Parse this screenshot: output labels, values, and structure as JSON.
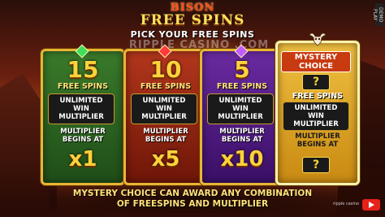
{
  "header": {
    "logo": "BISON",
    "title": "FREE SPINS",
    "subtitle": "PICK YOUR FREE SPINS",
    "watermark": "RIPPLE CASINO .COM"
  },
  "cards": [
    {
      "id": "green",
      "gem_color": "#3ee05a",
      "big_number": "15",
      "spins_label": "FREE SPINS",
      "pill_line1": "UNLIMITED",
      "pill_line2": "WIN",
      "pill_line3": "MULTIPLIER",
      "mult_line1": "MULTIPLIER",
      "mult_line2": "BEGINS AT",
      "mult_value": "x1"
    },
    {
      "id": "red",
      "gem_color": "#ff3a3a",
      "big_number": "10",
      "spins_label": "FREE SPINS",
      "pill_line1": "UNLIMITED",
      "pill_line2": "WIN",
      "pill_line3": "MULTIPLIER",
      "mult_line1": "MULTIPLIER",
      "mult_line2": "BEGINS AT",
      "mult_value": "x5"
    },
    {
      "id": "purple",
      "gem_color": "#c35cff",
      "big_number": "5",
      "spins_label": "FREE SPINS",
      "pill_line1": "UNLIMITED",
      "pill_line2": "WIN",
      "pill_line3": "MULTIPLIER",
      "mult_line1": "MULTIPLIER",
      "mult_line2": "BEGINS AT",
      "mult_value": "x10"
    },
    {
      "id": "gold",
      "head_line1": "MYSTERY",
      "head_line2": "CHOICE",
      "q_top": "?",
      "spins_label": "FREE SPINS",
      "pill_line1": "UNLIMITED",
      "pill_line2": "WIN",
      "pill_line3": "MULTIPLIER",
      "mult_line1": "MULTIPLIER",
      "mult_line2": "BEGINS AT",
      "q_bottom": "?"
    }
  ],
  "footer": {
    "line1": "MYSTERY CHOICE CAN AWARD ANY COMBINATION",
    "line2": "OF FREESPINS AND MULTIPLIER"
  },
  "overlay": {
    "side_tab": "DEMO PLAY",
    "corner_text": "ripple casino"
  },
  "colors": {
    "accent": "#ffd23a",
    "card_border": "#e8b535"
  }
}
